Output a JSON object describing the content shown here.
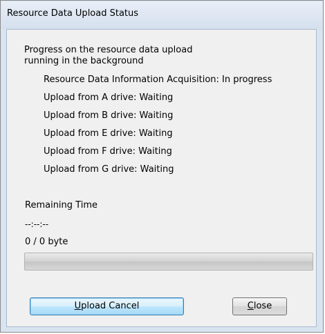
{
  "window": {
    "title": "Resource Data Upload Status"
  },
  "dialog": {
    "heading_line1": "Progress on the resource data upload",
    "heading_line2": "running in the background",
    "status_items": [
      "Resource Data Information Acquisition: In progress",
      "Upload from A drive: Waiting",
      "Upload from B drive: Waiting",
      "Upload from E drive: Waiting",
      "Upload from F drive: Waiting",
      "Upload from G drive: Waiting"
    ],
    "remaining_time_label": "Remaining Time",
    "remaining_time_value": "--:--:--",
    "bytes_text": "0 / 0 byte",
    "progress_fraction": 0
  },
  "buttons": {
    "upload_cancel_accel": "U",
    "upload_cancel_rest": "pload Cancel",
    "close_accel": "C",
    "close_rest": "lose"
  },
  "colors": {
    "window_frame": "#d9e4f1",
    "client_bg": "#f0f0f0",
    "default_button_border": "#3c7fb1"
  }
}
